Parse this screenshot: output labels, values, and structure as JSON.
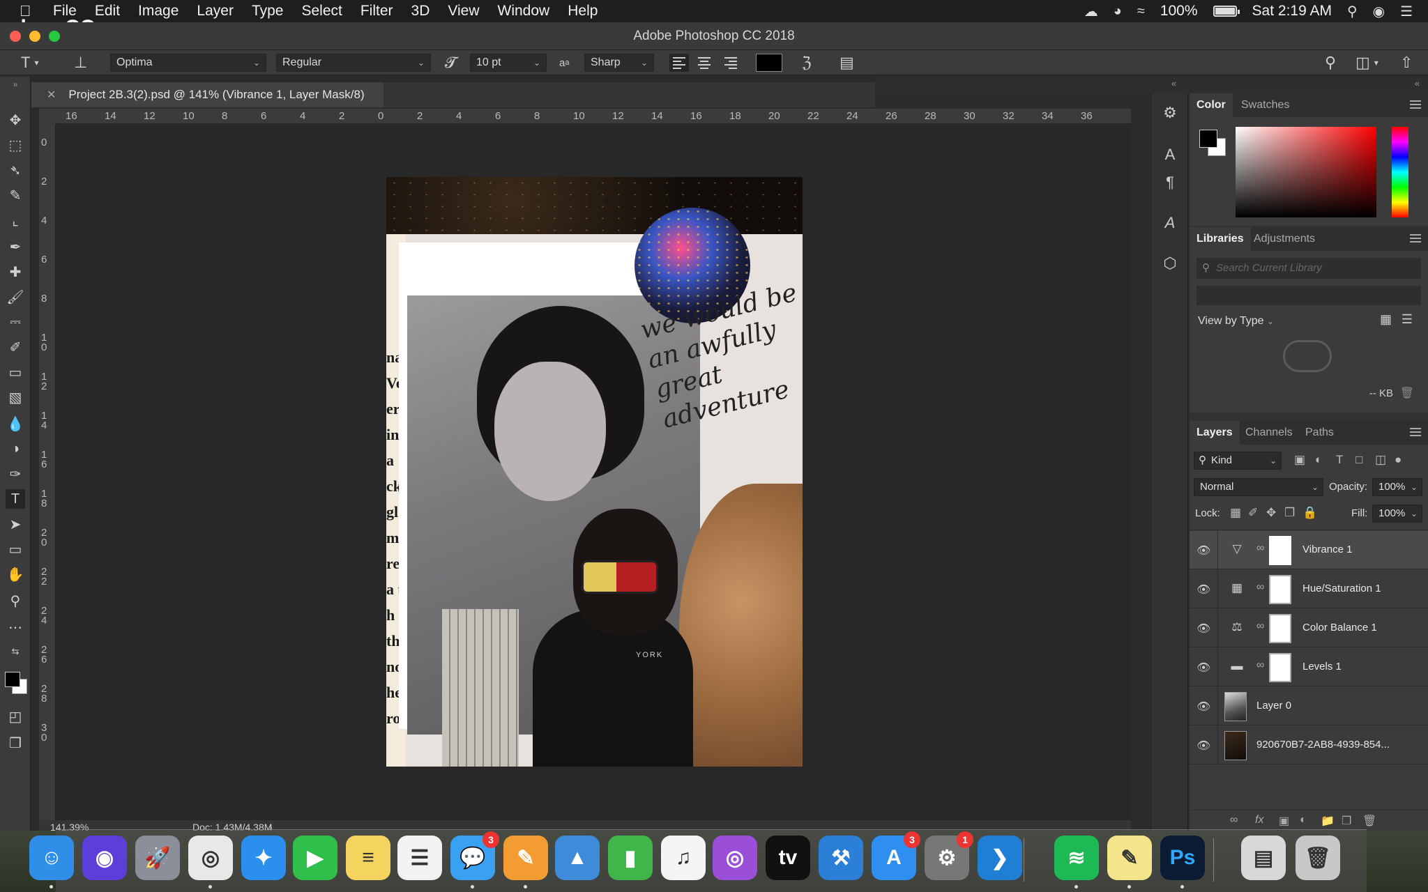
{
  "menubar": {
    "app_name": "Photoshop CC",
    "items": [
      "File",
      "Edit",
      "Image",
      "Layer",
      "Type",
      "Select",
      "Filter",
      "3D",
      "View",
      "Window",
      "Help"
    ],
    "battery": "100%",
    "battery_level": 1.0,
    "clock": "Sat 2:19 AM"
  },
  "window": {
    "title": "Adobe Photoshop CC 2018"
  },
  "options_bar": {
    "font_family": "Optima",
    "font_style": "Regular",
    "font_size": "10 pt",
    "aa_label": "a",
    "anti_alias": "Sharp",
    "text_color": "#000000"
  },
  "document": {
    "tab_title": "Project 2B.3(2).psd @ 141% (Vibrance 1, Layer Mask/8)",
    "zoom": "141.39%",
    "doc_size": "Doc: 1.43M/4.38M",
    "ruler_h": [
      "16",
      "14",
      "12",
      "10",
      "8",
      "6",
      "4",
      "2",
      "0",
      "2",
      "4",
      "6",
      "8",
      "10",
      "12",
      "14",
      "16",
      "18",
      "20",
      "22",
      "24",
      "26",
      "28",
      "30",
      "32",
      "34",
      "36"
    ],
    "ruler_v": [
      "0",
      "2",
      "4",
      "6",
      "8",
      "10",
      "12",
      "14",
      "16",
      "18",
      "20",
      "22",
      "24",
      "26",
      "28",
      "30"
    ]
  },
  "artwork": {
    "news_text": "na Ve er ing a ck gl m f re a u h th nom he rock",
    "handwriting": "we would be an awfully great adventure",
    "shirt_text": "YORK"
  },
  "color_panel": {
    "tabs": [
      "Color",
      "Swatches"
    ],
    "foreground": "#000000",
    "background": "#ffffff"
  },
  "libraries_panel": {
    "tabs": [
      "Libraries",
      "Adjustments"
    ],
    "search_placeholder": "Search Current Library",
    "view_by": "View by Type",
    "size": "-- KB"
  },
  "layers_panel": {
    "tabs": [
      "Layers",
      "Channels",
      "Paths"
    ],
    "filter_kind": "Kind",
    "blend_mode": "Normal",
    "opacity_label": "Opacity:",
    "opacity": "100%",
    "lock_label": "Lock:",
    "fill_label": "Fill:",
    "fill": "100%",
    "layers": [
      {
        "name": "Vibrance 1",
        "type": "adjustment",
        "icon": "vibrance-icon",
        "selected": true
      },
      {
        "name": "Hue/Saturation 1",
        "type": "adjustment",
        "icon": "hue-saturation-icon",
        "selected": false
      },
      {
        "name": "Color Balance 1",
        "type": "adjustment",
        "icon": "color-balance-icon",
        "selected": false
      },
      {
        "name": "Levels 1",
        "type": "adjustment",
        "icon": "levels-icon",
        "selected": false
      },
      {
        "name": "Layer 0",
        "type": "pixel",
        "selected": false
      },
      {
        "name": "920670B7-2AB8-4939-854...",
        "type": "smart-object",
        "selected": false
      }
    ]
  },
  "dock": {
    "apps": [
      {
        "name": "Finder",
        "icon": "finder-icon",
        "color": "#2f8fe8"
      },
      {
        "name": "Siri",
        "icon": "siri-icon",
        "color": "#5b3fd8"
      },
      {
        "name": "Launchpad",
        "icon": "launchpad-icon",
        "color": "#8a8f99"
      },
      {
        "name": "Chrome",
        "icon": "chrome-icon",
        "color": "#e8e8e8"
      },
      {
        "name": "Safari",
        "icon": "safari-icon",
        "color": "#2b8ff0"
      },
      {
        "name": "FaceTime",
        "icon": "facetime-icon",
        "color": "#2fbf4a"
      },
      {
        "name": "Notes",
        "icon": "notes-icon",
        "color": "#f4d35e"
      },
      {
        "name": "Reminders",
        "icon": "reminders-icon",
        "color": "#f2f2f2"
      },
      {
        "name": "Messages",
        "icon": "messages-icon",
        "color": "#3aa0f2",
        "badge": "3"
      },
      {
        "name": "Pages",
        "icon": "pages-icon",
        "color": "#f39c33"
      },
      {
        "name": "Keynote",
        "icon": "keynote-icon",
        "color": "#3d8bd9"
      },
      {
        "name": "Numbers",
        "icon": "numbers-icon",
        "color": "#3fb54a"
      },
      {
        "name": "Music",
        "icon": "music-icon",
        "color": "#f5f5f5"
      },
      {
        "name": "Podcasts",
        "icon": "podcasts-icon",
        "color": "#9b4fd8"
      },
      {
        "name": "TV",
        "icon": "tv-icon",
        "color": "#111111"
      },
      {
        "name": "Xcode",
        "icon": "xcode-icon",
        "color": "#2c7fd6"
      },
      {
        "name": "App Store",
        "icon": "app-store-icon",
        "color": "#2f8ff0",
        "badge": "3"
      },
      {
        "name": "System Preferences",
        "icon": "system-preferences-icon",
        "color": "#777777",
        "badge": "1"
      },
      {
        "name": "Visual Studio Code",
        "icon": "vscode-icon",
        "color": "#1f7fd4"
      },
      {
        "name": "Spotify",
        "icon": "spotify-icon",
        "color": "#1db954"
      },
      {
        "name": "Stickies",
        "icon": "stickies-icon",
        "color": "#f4e58a"
      },
      {
        "name": "Photoshop",
        "icon": "photoshop-icon",
        "color": "#0b1b33",
        "label": "Ps"
      },
      {
        "name": "Documents",
        "icon": "documents-folder-icon",
        "color": "#d8d8d8"
      },
      {
        "name": "Trash",
        "icon": "trash-icon",
        "color": "#c8c8c8"
      }
    ]
  }
}
